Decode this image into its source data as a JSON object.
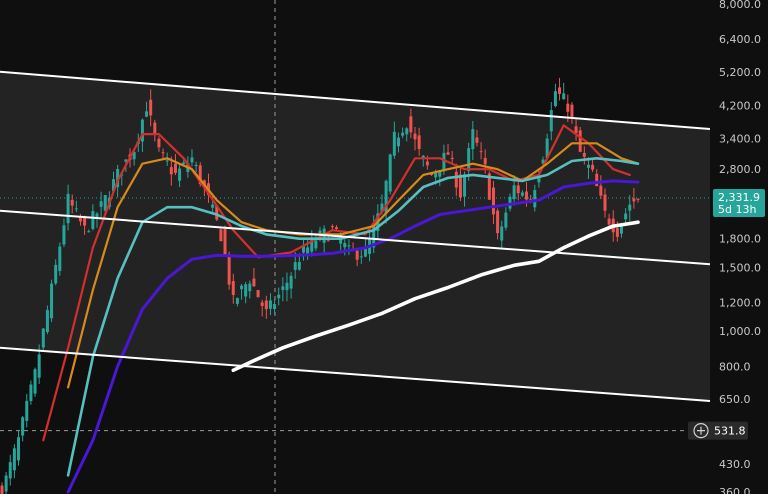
{
  "chart_data": {
    "type": "candlestick",
    "y_scale": "log",
    "ylim": [
      360,
      8000
    ],
    "y_ticks": [
      8000,
      6400,
      5200,
      4200,
      3400,
      2800,
      2300,
      1800,
      1500,
      1200,
      1000,
      800,
      650,
      430,
      360
    ],
    "y_tick_labels": [
      "8,000.0",
      "6,400.0",
      "5,200.0",
      "4,200.0",
      "3,400.0",
      "2,800.0",
      "",
      "1,800.0",
      "1,500.0",
      "1,200.0",
      "1,000.0",
      "800.0",
      "650.0",
      "430.0",
      "360.0"
    ],
    "grid": false,
    "current_price": {
      "value": 2331.9,
      "label": "2,331.9",
      "countdown": "5d 13h",
      "color": "#26a69a"
    },
    "crosshair": {
      "value": 531.8,
      "label": "531.8"
    },
    "colors": {
      "up": "#26a69a",
      "down": "#ef5350",
      "ma_red": "#d32f2f",
      "ma_orange": "#d98a1a",
      "ma_teal": "#56c0c0",
      "ma_purple": "#4a17d6",
      "ma_white": "#ffffff",
      "channel": "#ffffff",
      "channel_fill": "#2b2b2b"
    },
    "n_bars": 160,
    "close_keys": [
      [
        0,
        360
      ],
      [
        4,
        500
      ],
      [
        8,
        760
      ],
      [
        12,
        1300
      ],
      [
        16,
        2300
      ],
      [
        20,
        1900
      ],
      [
        24,
        2200
      ],
      [
        28,
        2700
      ],
      [
        32,
        3200
      ],
      [
        35,
        4200
      ],
      [
        38,
        3100
      ],
      [
        42,
        2700
      ],
      [
        46,
        3000
      ],
      [
        50,
        2300
      ],
      [
        53,
        1850
      ],
      [
        56,
        1200
      ],
      [
        60,
        1400
      ],
      [
        64,
        1120
      ],
      [
        68,
        1300
      ],
      [
        72,
        1600
      ],
      [
        76,
        1800
      ],
      [
        80,
        1900
      ],
      [
        84,
        1650
      ],
      [
        88,
        1650
      ],
      [
        92,
        2200
      ],
      [
        95,
        3400
      ],
      [
        98,
        3800
      ],
      [
        101,
        3100
      ],
      [
        104,
        2700
      ],
      [
        108,
        3100
      ],
      [
        111,
        2400
      ],
      [
        114,
        3500
      ],
      [
        117,
        2800
      ],
      [
        120,
        1800
      ],
      [
        124,
        2500
      ],
      [
        128,
        2300
      ],
      [
        131,
        3100
      ],
      [
        134,
        4600
      ],
      [
        137,
        4200
      ],
      [
        140,
        3100
      ],
      [
        143,
        2700
      ],
      [
        146,
        2100
      ],
      [
        149,
        1900
      ],
      [
        152,
        2250
      ],
      [
        154,
        2331.9
      ]
    ],
    "moving_averages": [
      {
        "key": "ma_red",
        "points": [
          [
            10,
            500
          ],
          [
            16,
            900
          ],
          [
            22,
            1700
          ],
          [
            28,
            2600
          ],
          [
            34,
            3500
          ],
          [
            38,
            3500
          ],
          [
            44,
            3000
          ],
          [
            50,
            2400
          ],
          [
            56,
            1900
          ],
          [
            62,
            1600
          ],
          [
            70,
            1650
          ],
          [
            80,
            1900
          ],
          [
            88,
            1850
          ],
          [
            94,
            2300
          ],
          [
            100,
            3000
          ],
          [
            106,
            3000
          ],
          [
            112,
            2800
          ],
          [
            118,
            2800
          ],
          [
            124,
            2600
          ],
          [
            130,
            2700
          ],
          [
            136,
            3700
          ],
          [
            142,
            3300
          ],
          [
            148,
            2800
          ],
          [
            152,
            2700
          ]
        ]
      },
      {
        "key": "ma_orange",
        "points": [
          [
            16,
            700
          ],
          [
            22,
            1300
          ],
          [
            28,
            2200
          ],
          [
            34,
            2900
          ],
          [
            40,
            3000
          ],
          [
            46,
            2800
          ],
          [
            52,
            2300
          ],
          [
            58,
            2000
          ],
          [
            64,
            1900
          ],
          [
            72,
            1850
          ],
          [
            82,
            1850
          ],
          [
            90,
            1950
          ],
          [
            96,
            2300
          ],
          [
            102,
            2700
          ],
          [
            108,
            2800
          ],
          [
            114,
            2900
          ],
          [
            120,
            2800
          ],
          [
            126,
            2600
          ],
          [
            132,
            2900
          ],
          [
            138,
            3300
          ],
          [
            144,
            3300
          ],
          [
            150,
            3000
          ],
          [
            154,
            2900
          ]
        ]
      },
      {
        "key": "ma_teal",
        "points": [
          [
            16,
            400
          ],
          [
            22,
            850
          ],
          [
            28,
            1400
          ],
          [
            34,
            2000
          ],
          [
            40,
            2200
          ],
          [
            46,
            2200
          ],
          [
            52,
            2100
          ],
          [
            58,
            1950
          ],
          [
            64,
            1850
          ],
          [
            72,
            1800
          ],
          [
            82,
            1800
          ],
          [
            90,
            1900
          ],
          [
            96,
            2150
          ],
          [
            102,
            2500
          ],
          [
            108,
            2650
          ],
          [
            114,
            2700
          ],
          [
            120,
            2650
          ],
          [
            126,
            2600
          ],
          [
            132,
            2700
          ],
          [
            138,
            2950
          ],
          [
            144,
            3000
          ],
          [
            150,
            2950
          ],
          [
            154,
            2900
          ]
        ]
      },
      {
        "key": "ma_purple",
        "points": [
          [
            16,
            360
          ],
          [
            22,
            500
          ],
          [
            28,
            800
          ],
          [
            34,
            1150
          ],
          [
            40,
            1400
          ],
          [
            46,
            1580
          ],
          [
            52,
            1620
          ],
          [
            58,
            1610
          ],
          [
            64,
            1610
          ],
          [
            72,
            1620
          ],
          [
            80,
            1640
          ],
          [
            88,
            1700
          ],
          [
            94,
            1800
          ],
          [
            100,
            1950
          ],
          [
            106,
            2100
          ],
          [
            112,
            2150
          ],
          [
            118,
            2200
          ],
          [
            124,
            2250
          ],
          [
            130,
            2300
          ],
          [
            136,
            2500
          ],
          [
            142,
            2560
          ],
          [
            148,
            2600
          ],
          [
            154,
            2580
          ]
        ]
      },
      {
        "key": "ma_white",
        "points": [
          [
            56,
            780
          ],
          [
            62,
            840
          ],
          [
            68,
            900
          ],
          [
            76,
            970
          ],
          [
            84,
            1040
          ],
          [
            92,
            1120
          ],
          [
            100,
            1230
          ],
          [
            108,
            1320
          ],
          [
            116,
            1430
          ],
          [
            124,
            1520
          ],
          [
            130,
            1560
          ],
          [
            136,
            1700
          ],
          [
            142,
            1830
          ],
          [
            148,
            1950
          ],
          [
            154,
            2000
          ]
        ]
      }
    ],
    "channel": {
      "upper": [
        [
          0,
          5200
        ],
        [
          154,
          3750
        ]
      ],
      "middle": [
        [
          0,
          2150
        ],
        [
          165,
          1550
        ]
      ],
      "lower": [
        [
          0,
          900
        ],
        [
          165,
          650
        ]
      ]
    }
  }
}
